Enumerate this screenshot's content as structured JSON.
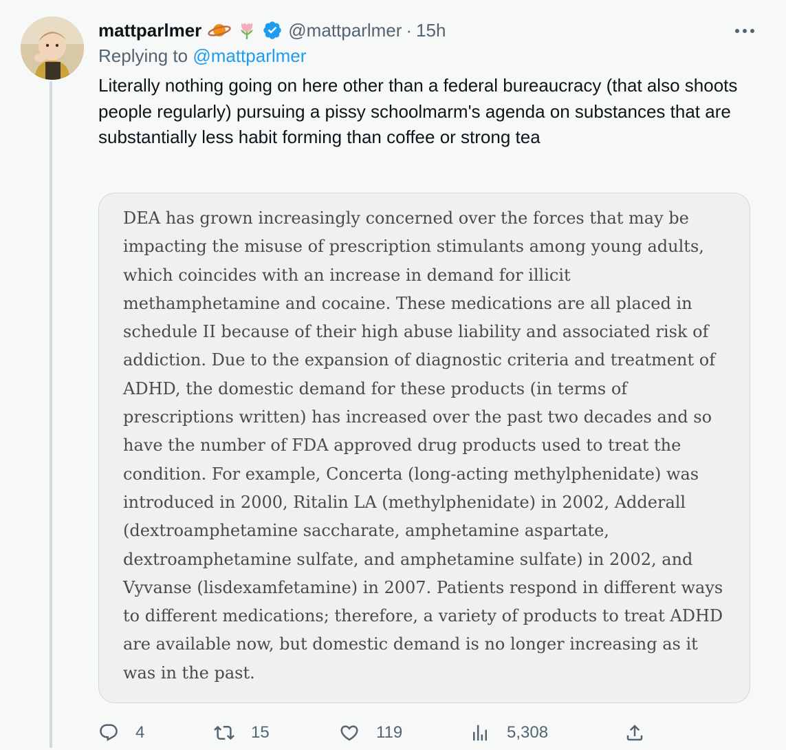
{
  "tweet": {
    "display_name": "mattparlmer",
    "emoji": [
      "planet-ringed-emoji",
      "tulip-emoji"
    ],
    "verified": true,
    "handle": "@mattparlmer",
    "separator": "·",
    "time": "15h",
    "replying_prefix": "Replying to",
    "replying_to": "@mattparlmer",
    "text": "Literally nothing going on here other than a federal bureaucracy (that also shoots people regularly) pursuing a pissy schoolmarm's agenda on substances that are substantially less habit forming than coffee or strong tea",
    "quote_image_text": "DEA has grown increasingly concerned over the forces that may be impacting the misuse of prescription stimulants among young adults, which coincides with an increase in demand for illicit methamphetamine and cocaine. These medications are all placed in schedule II because of their high abuse liability and associated risk of addiction. Due to the expansion of diagnostic criteria and treatment of ADHD, the domestic demand for these products (in terms of prescriptions written) has increased over the past two decades and so have the number of FDA approved drug products used to treat the condition. For example, Concerta (long-acting methylphenidate) was introduced in 2000, Ritalin LA (methylphenidate) in 2002, Adderall (dextroamphetamine saccharate, amphetamine aspartate, dextroamphetamine sulfate, and amphetamine sulfate) in 2002, and Vyvanse (lisdexamfetamine) in 2007. Patients respond in different ways to different medications; therefore, a variety of products to treat ADHD are available now, but domestic demand is no longer increasing as it was in the past."
  },
  "actions": {
    "replies": "4",
    "retweets": "15",
    "likes": "119",
    "views": "5,308"
  },
  "colors": {
    "background": "#f7f9f9",
    "text": "#0f1419",
    "secondary": "#536471",
    "link": "#1d9bf0",
    "verified_badge": "#1d9bf0",
    "quote_background": "#f0f0f0",
    "border": "#cfd9de"
  },
  "icons": [
    "more-icon",
    "reply-icon",
    "retweet-icon",
    "like-icon",
    "views-icon",
    "share-icon"
  ]
}
